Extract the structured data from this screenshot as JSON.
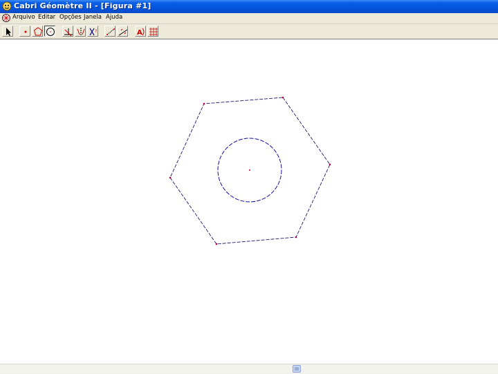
{
  "window": {
    "title": "Cabri Géomètre II - [Figura #1]"
  },
  "menu": [
    "Arquivo",
    "Editar",
    "Opções",
    "Janela",
    "Ajuda"
  ],
  "toolbar": {
    "tools": [
      {
        "icon": "pointer-icon"
      },
      {
        "icon": "point-icon"
      },
      {
        "icon": "regular-polygon-icon"
      },
      {
        "icon": "circle-icon",
        "selected": true
      },
      {
        "icon": "perpendicular-line-icon"
      },
      {
        "icon": "symmetry-icon"
      },
      {
        "icon": "check-property-icon"
      },
      {
        "icon": "measure-icon"
      },
      {
        "icon": "calculate-icon"
      },
      {
        "icon": "label-icon"
      },
      {
        "icon": "display-grid-icon"
      }
    ]
  },
  "figure": {
    "shapes": [
      "hexagon",
      "circle",
      "center-point"
    ],
    "colors": {
      "hexagon": "#1a1a6e",
      "vertex": "#b0004a",
      "circle": "#1010a0",
      "center": "#d00000"
    }
  },
  "scrollbar": {
    "horizontal": true
  }
}
